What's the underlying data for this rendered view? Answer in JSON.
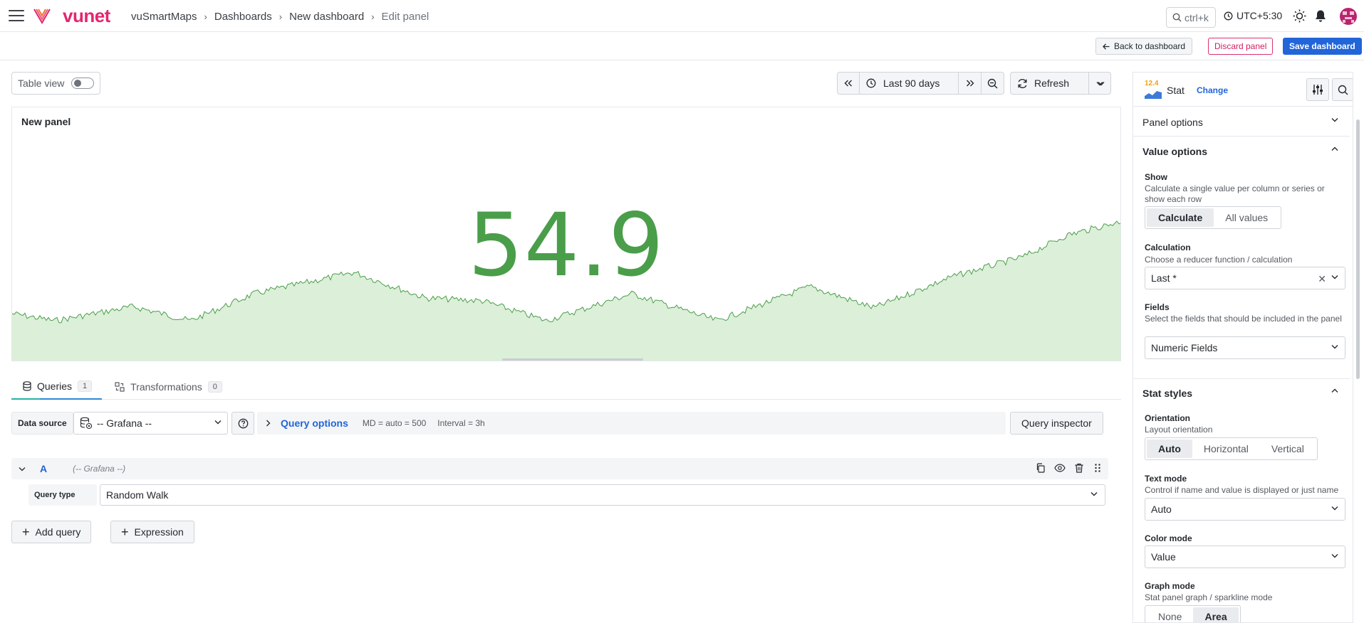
{
  "header": {
    "logo_text": "vunet",
    "breadcrumbs": [
      "vuSmartMaps",
      "Dashboards",
      "New dashboard",
      "Edit panel"
    ],
    "search_shortcut": "ctrl+k",
    "timezone": "UTC+5:30"
  },
  "actions": {
    "back": "Back to dashboard",
    "discard": "Discard panel",
    "save": "Save dashboard"
  },
  "toolbar": {
    "table_view": "Table view",
    "table_view_enabled": false,
    "time_range": "Last 90 days",
    "refresh": "Refresh"
  },
  "panel": {
    "title": "New panel",
    "stat_value": "54.9",
    "value_color": "#4a9e4a"
  },
  "tabs": [
    {
      "label": "Queries",
      "count": "1",
      "active": true
    },
    {
      "label": "Transformations",
      "count": "0",
      "active": false
    }
  ],
  "query": {
    "data_source_label": "Data source",
    "data_source": "-- Grafana --",
    "options_title": "Query options",
    "md": "MD = auto = 500",
    "interval": "Interval = 3h",
    "inspector": "Query inspector",
    "ref_id": "A",
    "ds_name": "(-- Grafana --)",
    "type_label": "Query type",
    "type_value": "Random Walk",
    "add_query": "Add query",
    "expression": "Expression"
  },
  "options_pane": {
    "viz_name": "Stat",
    "viz_icon_text": "12.4",
    "change": "Change",
    "panel_options": "Panel options",
    "value_options": "Value options",
    "show_label": "Show",
    "show_desc": "Calculate a single value per column or series or show each row",
    "show_opts": [
      "Calculate",
      "All values"
    ],
    "calc_label": "Calculation",
    "calc_desc": "Choose a reducer function / calculation",
    "calc_value": "Last *",
    "fields_label": "Fields",
    "fields_desc": "Select the fields that should be included in the panel",
    "fields_value": "Numeric Fields",
    "stat_styles": "Stat styles",
    "orientation_label": "Orientation",
    "orientation_desc": "Layout orientation",
    "orientation_opts": [
      "Auto",
      "Horizontal",
      "Vertical"
    ],
    "text_mode_label": "Text mode",
    "text_mode_desc": "Control if name and value is displayed or just name",
    "text_mode_value": "Auto",
    "color_mode_label": "Color mode",
    "color_mode_value": "Value",
    "graph_mode_label": "Graph mode",
    "graph_mode_desc": "Stat panel graph / sparkline mode",
    "graph_mode_opts": [
      "None",
      "Area"
    ]
  },
  "colors": {
    "accent_blue": "#2165d9",
    "discard_pink": "#d21e63",
    "stat_green": "#4a9e4a",
    "area_fill": "#dcefd9"
  }
}
